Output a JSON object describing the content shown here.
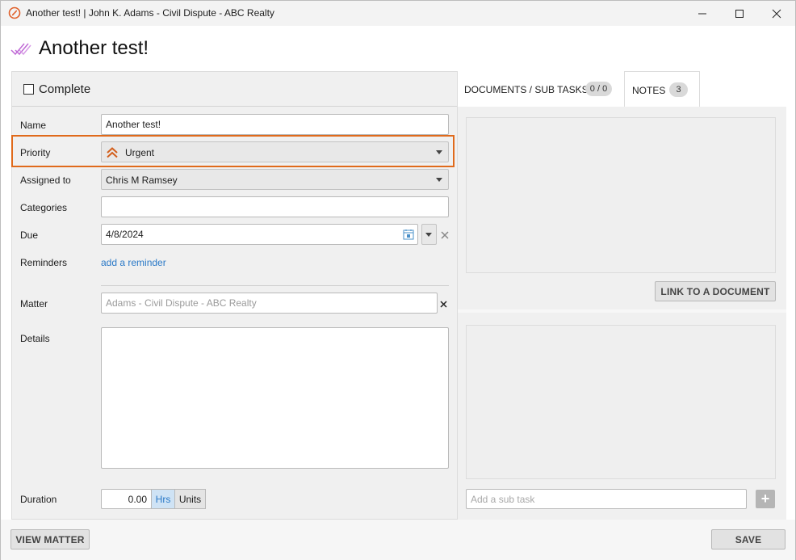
{
  "window": {
    "title": "Another test! | John K. Adams - Civil Dispute - ABC Realty",
    "minimize_glyph": "—",
    "maximize_glyph": "☐",
    "close_glyph": "✕"
  },
  "header": {
    "title": "Another test!",
    "icon": "task-check-icon"
  },
  "task": {
    "complete_label": "Complete",
    "complete_checked": false
  },
  "fields": {
    "name_label": "Name",
    "name_value": "Another test!",
    "priority_label": "Priority",
    "priority_value": "Urgent",
    "priority_icon": "double-chevron-up-icon",
    "priority_color": "#d35f1c",
    "assigned_label": "Assigned to",
    "assigned_value": "Chris M Ramsey",
    "categories_label": "Categories",
    "categories_value": "",
    "due_label": "Due",
    "due_value": "4/8/2024",
    "reminders_label": "Reminders",
    "reminders_link": "add a reminder",
    "matter_label": "Matter",
    "matter_placeholder": "Adams - Civil Dispute - ABC Realty",
    "details_label": "Details",
    "details_value": "",
    "duration_label": "Duration",
    "duration_value": "0.00",
    "duration_unit_hrs": "Hrs",
    "duration_unit_units": "Units",
    "duration_selected_unit": "Hrs"
  },
  "tabs": [
    {
      "label": "DOCUMENTS / SUB TASKS",
      "badge": "0 / 0"
    },
    {
      "label": "NOTES",
      "badge": "3"
    }
  ],
  "documents": {
    "link_button": "LINK TO A DOCUMENT"
  },
  "subtasks": {
    "placeholder": "Add a sub task",
    "add_glyph": "+"
  },
  "footer": {
    "view_matter": "VIEW MATTER",
    "save": "SAVE"
  },
  "colors": {
    "accent_orange": "#e06a1b",
    "link_blue": "#2a79c7",
    "header_icon_purple": "#b44fc9",
    "selected_unit_bg": "#cfe3f5"
  }
}
